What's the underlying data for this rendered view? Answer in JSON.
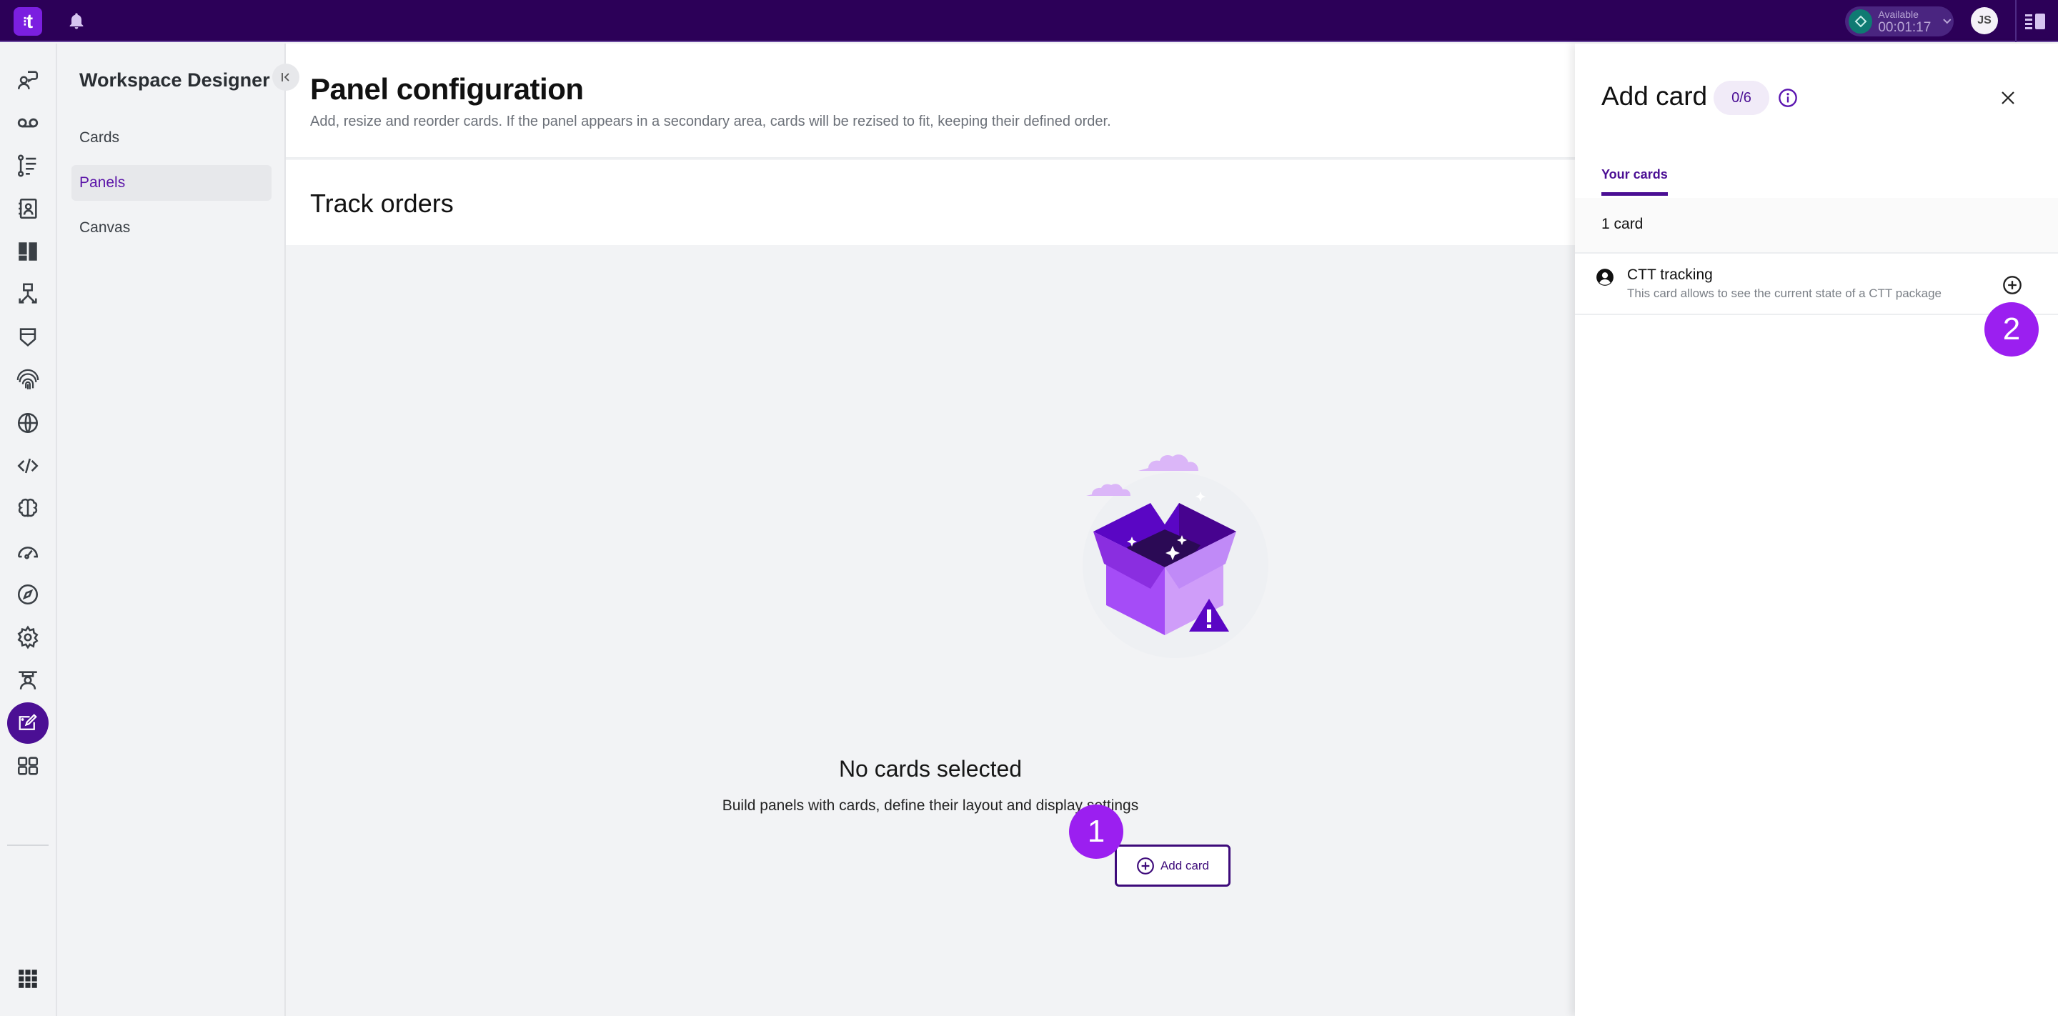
{
  "topbar": {
    "logo_text": "t",
    "status": {
      "label": "Available",
      "timer": "00:01:17",
      "color": "#0f7a72"
    },
    "user_initials": "JS"
  },
  "rail": {
    "items": [
      {
        "icon": "agent-chat-icon"
      },
      {
        "icon": "voicemail-icon"
      },
      {
        "icon": "workflow-list-icon"
      },
      {
        "icon": "contacts-book-icon"
      },
      {
        "icon": "dashboard-layout-icon"
      },
      {
        "icon": "routing-icon"
      },
      {
        "icon": "shield-icon"
      },
      {
        "icon": "fingerprint-icon"
      },
      {
        "icon": "globe-icon"
      },
      {
        "icon": "code-icon"
      },
      {
        "icon": "brain-icon"
      },
      {
        "icon": "speedometer-icon"
      },
      {
        "icon": "compass-icon"
      },
      {
        "icon": "settings-gear-icon"
      },
      {
        "icon": "supervisor-icon"
      },
      {
        "icon": "workspace-designer-icon",
        "active": true
      },
      {
        "icon": "apps-grid-icon"
      }
    ],
    "bottom_icon": "app-launcher-icon"
  },
  "subnav": {
    "title": "Workspace Designer",
    "items": [
      {
        "label": "Cards",
        "active": false
      },
      {
        "label": "Panels",
        "active": true
      },
      {
        "label": "Canvas",
        "active": false
      }
    ]
  },
  "main": {
    "title": "Panel configuration",
    "subtitle": "Add, resize and reorder cards. If the panel appears in a secondary area, cards will be rezised to fit, keeping their defined order.",
    "panel_name": "Track orders",
    "empty_state": {
      "title": "No cards selected",
      "description": "Build panels with cards, define their layout and display settings",
      "button_label": "Add card"
    }
  },
  "drawer": {
    "title": "Add card",
    "count_badge": "0/6",
    "tabs": [
      {
        "label": "Your cards",
        "active": true
      }
    ],
    "count_label": "1 card",
    "cards": [
      {
        "name": "CTT tracking",
        "description": "This card allows to see the current state of a CTT package"
      }
    ]
  },
  "step_badges": [
    "1",
    "2"
  ],
  "colors": {
    "topbar": "#2c0058",
    "accent": "#4b0f94",
    "step_badge": "#9b1ff0",
    "logo": "#7b1fe0"
  }
}
